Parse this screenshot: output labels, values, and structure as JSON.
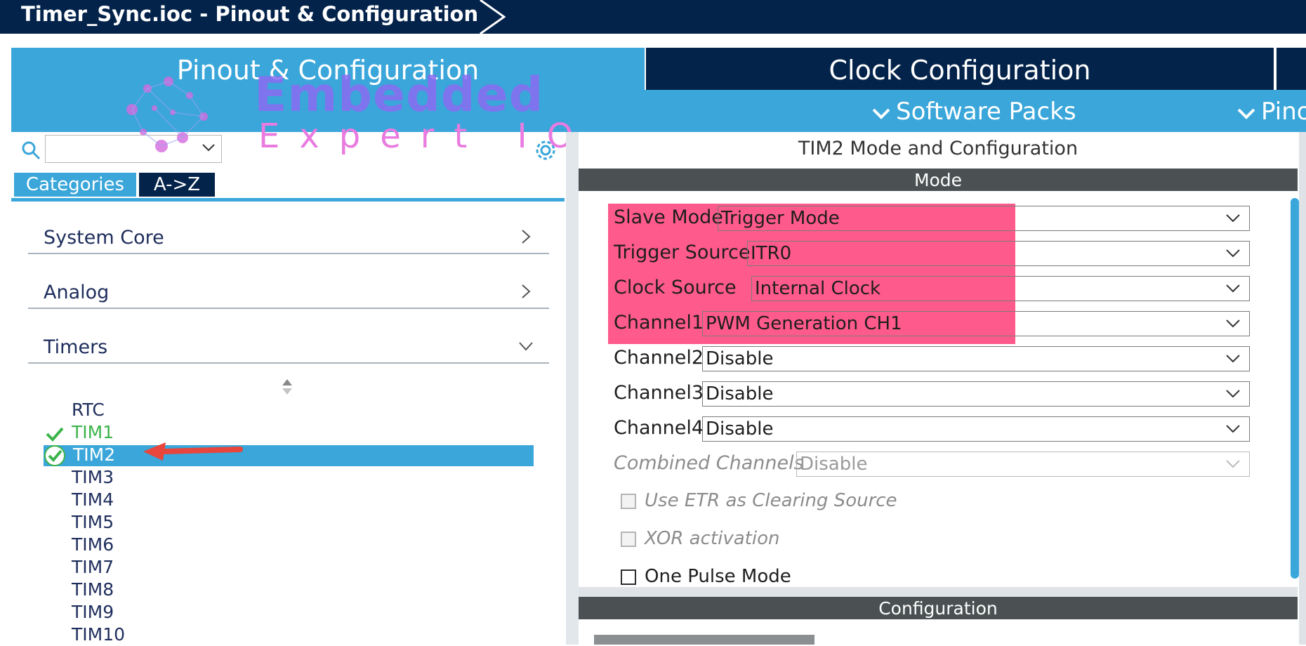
{
  "breadcrumb": {
    "title": "Timer_Sync.ioc - Pinout & Configuration"
  },
  "top_tabs": {
    "pinout": "Pinout & Configuration",
    "clock": "Clock Configuration"
  },
  "sub_menu": {
    "software_packs": "Software Packs",
    "pinout": "Pino"
  },
  "watermark": {
    "title": "Embedded",
    "subtitle": "Expert IO"
  },
  "left_panel": {
    "search": {
      "value": "",
      "placeholder": ""
    },
    "tabs": {
      "categories": "Categories",
      "az": "A->Z"
    },
    "categories": [
      {
        "label": "System Core",
        "expanded": false
      },
      {
        "label": "Analog",
        "expanded": false
      },
      {
        "label": "Timers",
        "expanded": true
      }
    ],
    "timers": [
      "RTC",
      "TIM1",
      "TIM2",
      "TIM3",
      "TIM4",
      "TIM5",
      "TIM6",
      "TIM7",
      "TIM8",
      "TIM9",
      "TIM10"
    ],
    "selected_timer": "TIM2",
    "configured_timers": [
      "TIM1",
      "TIM2"
    ]
  },
  "right_panel": {
    "title": "TIM2 Mode and Configuration",
    "mode_header": "Mode",
    "fields": [
      {
        "label": "Slave Mode",
        "value": "Trigger Mode"
      },
      {
        "label": "Trigger Source",
        "value": "ITR0"
      },
      {
        "label": "Clock Source",
        "value": "Internal Clock"
      },
      {
        "label": "Channel1",
        "value": "PWM Generation CH1"
      },
      {
        "label": "Channel2",
        "value": "Disable"
      },
      {
        "label": "Channel3",
        "value": "Disable"
      },
      {
        "label": "Channel4",
        "value": "Disable"
      },
      {
        "label": "Combined Channels",
        "value": "Disable"
      }
    ],
    "checkboxes": [
      {
        "label": "Use ETR as Clearing Source",
        "checked": false,
        "enabled": false
      },
      {
        "label": "XOR activation",
        "checked": false,
        "enabled": false
      },
      {
        "label": "One Pulse Mode",
        "checked": false,
        "enabled": true
      }
    ],
    "config_header": "Configuration"
  },
  "colors": {
    "navy": "#03234b",
    "accent_blue": "#3aa6da",
    "highlight_pink": "#ff5a8c",
    "check_green": "#3cb44b",
    "arrow_red": "#e8453c"
  },
  "icons": [
    "search-icon",
    "gear-icon",
    "chevron-right-icon",
    "chevron-down-icon",
    "checkmark-icon",
    "red-arrow-icon"
  ]
}
